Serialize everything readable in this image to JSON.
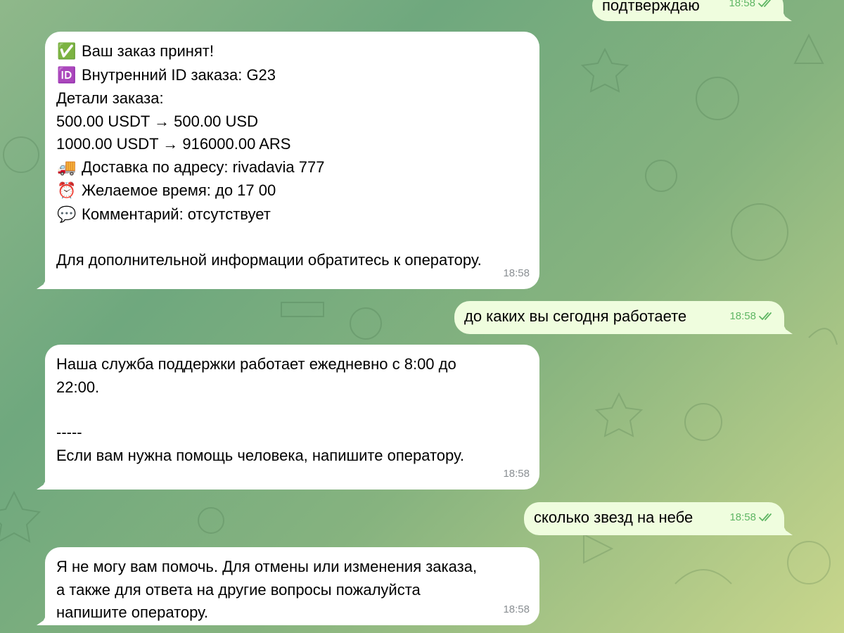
{
  "messages": [
    {
      "direction": "outgoing",
      "text": "подтверждаю",
      "time": "18:58",
      "status": "read"
    },
    {
      "direction": "incoming",
      "lines": [
        {
          "emoji": "✅",
          "icon": "check-mark-button-icon",
          "text": "Ваш заказ принят!"
        },
        {
          "emoji": "🆔",
          "icon": "id-badge-icon",
          "text": "Внутренний ID заказа: G23"
        },
        {
          "text": "Детали заказа:"
        },
        {
          "text": "500.00 USDT → 500.00 USD"
        },
        {
          "text": "1000.00 USDT → 916000.00 ARS"
        },
        {
          "emoji": "🚚",
          "icon": "delivery-truck-icon",
          "text": "Доставка по адресу: rivadavia 777"
        },
        {
          "emoji": "⏰",
          "icon": "alarm-clock-icon",
          "text": "Желаемое время: до 17 00"
        },
        {
          "emoji": "💬",
          "icon": "speech-bubble-icon",
          "text": "Комментарий: отсутствует"
        },
        {
          "text": ""
        },
        {
          "text": "Для дополнительной информации обратитесь к оператору."
        }
      ],
      "time": "18:58"
    },
    {
      "direction": "outgoing",
      "text": "до каких вы сегодня работаете",
      "time": "18:58",
      "status": "read"
    },
    {
      "direction": "incoming",
      "lines": [
        {
          "text": "Наша служба поддержки работает ежедневно с 8:00 до"
        },
        {
          "text": "22:00."
        },
        {
          "text": ""
        },
        {
          "text": "-----"
        },
        {
          "text": "Если вам нужна помощь человека, напишите оператору."
        }
      ],
      "time": "18:58"
    },
    {
      "direction": "outgoing",
      "text": "сколько звезд на небе",
      "time": "18:58",
      "status": "read"
    },
    {
      "direction": "incoming",
      "lines": [
        {
          "text": "Я не могу вам помочь. Для отмены или изменения заказа,"
        },
        {
          "text": "а также для ответа на другие вопросы пожалуйста"
        },
        {
          "text": "напишите оператору."
        }
      ],
      "time": "18:58"
    }
  ],
  "colors": {
    "incoming_bubble": "#ffffff",
    "outgoing_bubble": "#effdde",
    "read_check": "#5fb664",
    "time_incoming": "#8a8f93"
  }
}
